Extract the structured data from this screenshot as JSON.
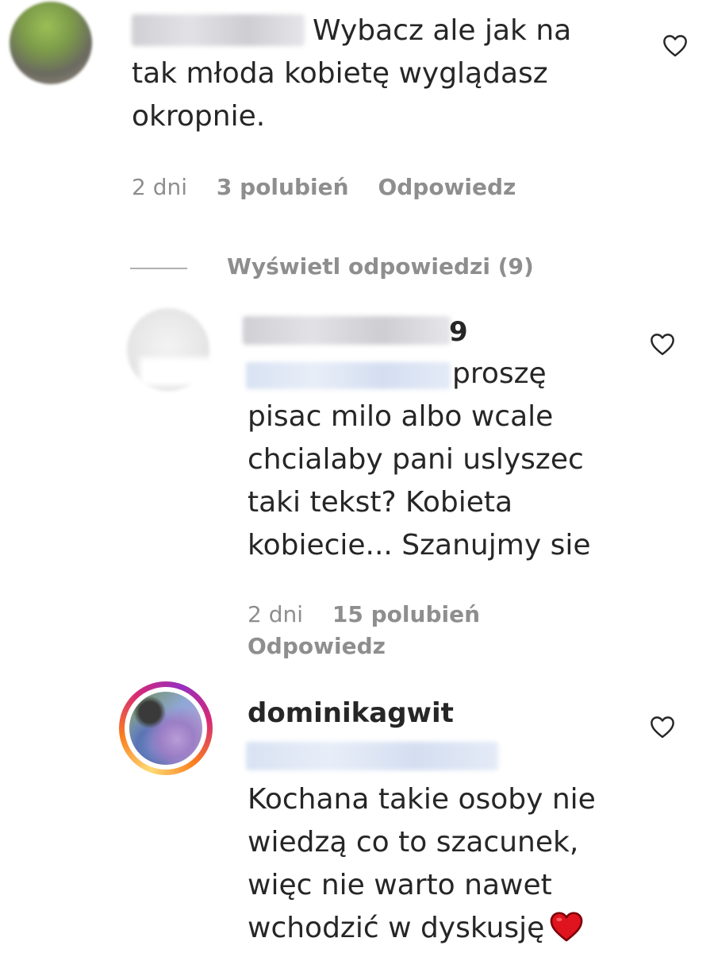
{
  "comment": {
    "text": "Wybacz ale jak na\ntak młoda kobietę wyglądasz\nokropnie.",
    "time": "2 dni",
    "likes": "3 polubień",
    "reply": "Odpowiedz"
  },
  "view_replies": "Wyświetl odpowiedzi (9)",
  "replies": [
    {
      "username_suffix": "9",
      "text": "proszę\npisac milo albo wcale\nchcialaby pani uslyszec\ntaki tekst? Kobieta\nkobiecie... Szanujmy sie",
      "time": "2 dni",
      "likes": "15 polubień",
      "reply": "Odpowiedz"
    },
    {
      "username": "dominikagwit",
      "text": "Kochana takie osoby nie\nwiedzą co to szacunek,\nwięc nie warto nawet\nwchodzić w dyskusję"
    }
  ],
  "icons": {
    "like": "heart-outline-icon",
    "emoji": "red-heart-emoji",
    "emoji_color": "#e0141e"
  }
}
